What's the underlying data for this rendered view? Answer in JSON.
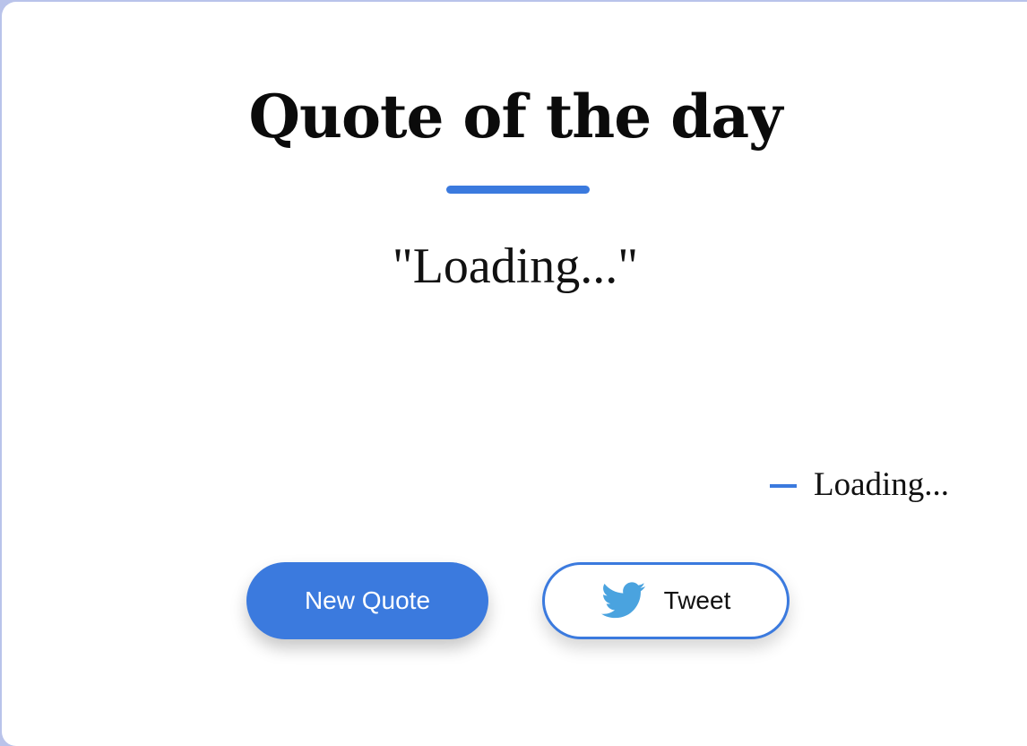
{
  "title": "Quote of the day",
  "quote": {
    "text": "\"Loading...\"",
    "author": "Loading..."
  },
  "buttons": {
    "new_quote_label": "New Quote",
    "tweet_label": "Tweet"
  },
  "icons": {
    "tweet": "twitter-bird-icon"
  },
  "colors": {
    "accent": "#3b7ade",
    "twitter": "#4aa3df",
    "background": "#b9c3ea"
  }
}
